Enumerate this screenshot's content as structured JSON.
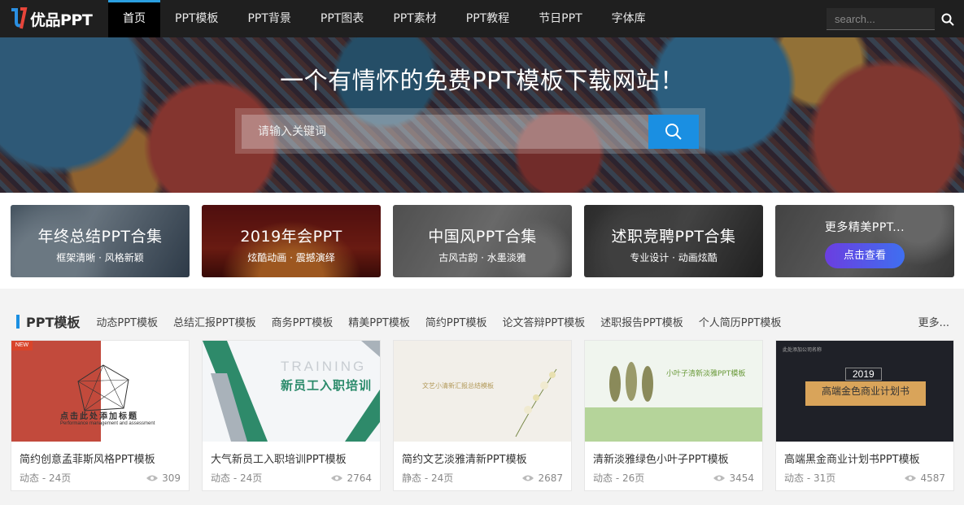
{
  "nav": {
    "logo_text": "优品PPT",
    "items": [
      {
        "label": "首页",
        "active": true
      },
      {
        "label": "PPT模板"
      },
      {
        "label": "PPT背景"
      },
      {
        "label": "PPT图表"
      },
      {
        "label": "PPT素材"
      },
      {
        "label": "PPT教程"
      },
      {
        "label": "节日PPT"
      },
      {
        "label": "字体库"
      }
    ],
    "search_placeholder": "search..."
  },
  "hero": {
    "title": "一个有情怀的免费PPT模板下载网站！",
    "search_placeholder": "请输入关键词"
  },
  "banners": [
    {
      "title": "年终总结PPT合集",
      "subtitle": "框架清晰 · 风格新颖"
    },
    {
      "title": "2019年会PPT",
      "subtitle": "炫酷动画 · 震撼演绎"
    },
    {
      "title": "中国风PPT合集",
      "subtitle": "古风古韵 · 水墨淡雅"
    },
    {
      "title": "述职竞聘PPT合集",
      "subtitle": "专业设计 · 动画炫酷"
    },
    {
      "title": "更多精美PPT...",
      "button": "点击查看"
    }
  ],
  "section": {
    "title": "PPT模板",
    "links": [
      "动态PPT模板",
      "总结汇报PPT模板",
      "商务PPT模板",
      "精美PPT模板",
      "简约PPT模板",
      "论文答辩PPT模板",
      "述职报告PPT模板",
      "个人简历PPT模板"
    ],
    "more": "更多..."
  },
  "cards": [
    {
      "title": "简约创意孟菲斯风格PPT模板",
      "meta": "动态 - 24页",
      "views": "309",
      "thumb": {
        "tag": "NEW",
        "headline": "点击此处添加标题",
        "sub": "Performance management and assessment"
      }
    },
    {
      "title": "大气新员工入职培训PPT模板",
      "meta": "动态 - 24页",
      "views": "2764",
      "thumb": {
        "en": "TRAINING",
        "headline": "新员工入职培训"
      }
    },
    {
      "title": "简约文艺淡雅清新PPT模板",
      "meta": "静态 - 24页",
      "views": "2687",
      "thumb": {
        "headline": "文艺小清新汇报总结模板"
      }
    },
    {
      "title": "清新淡雅绿色小叶子PPT模板",
      "meta": "动态 - 26页",
      "views": "3454",
      "thumb": {
        "headline": "小叶子清新淡雅PPT模板"
      }
    },
    {
      "title": "高端黑金商业计划书PPT模板",
      "meta": "动态 - 31页",
      "views": "4587",
      "thumb": {
        "top": "此处添加公司名称",
        "year": "2019",
        "headline": "高端金色商业计划书"
      }
    }
  ],
  "colors": {
    "accent": "#1a8fe2",
    "nav_bg": "#1f1f1f",
    "pill": "#5a4fe6"
  }
}
